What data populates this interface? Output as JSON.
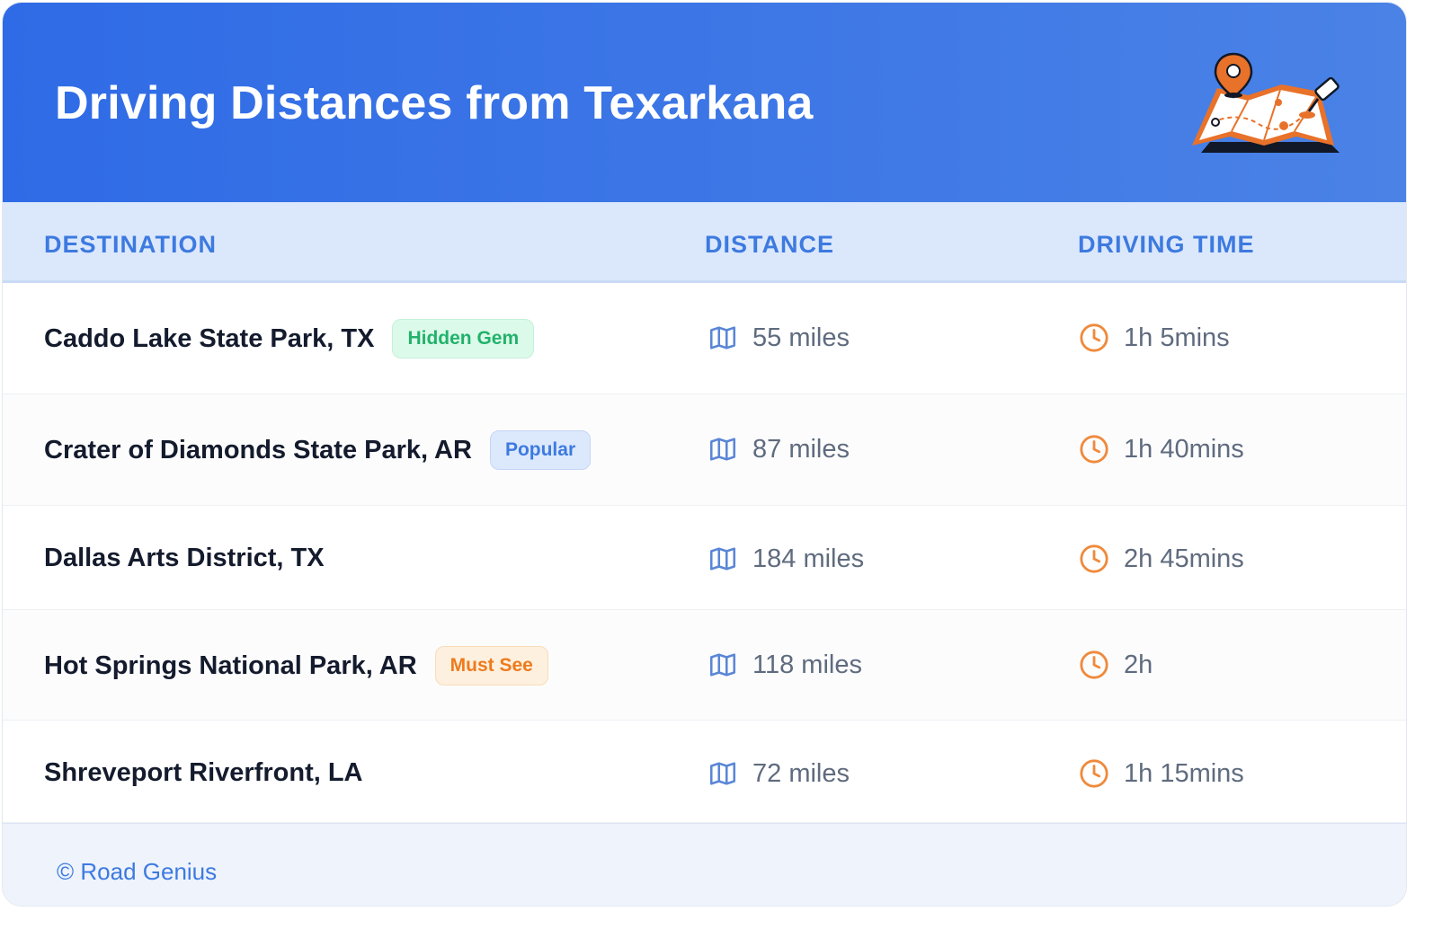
{
  "title": "Driving Distances from Texarkana",
  "columns": {
    "destination": "DESTINATION",
    "distance": "DISTANCE",
    "driving_time": "DRIVING TIME"
  },
  "rows": [
    {
      "destination": "Caddo Lake State Park, TX",
      "badge": "Hidden Gem",
      "badge_color": "#22b26b",
      "distance": "55 miles",
      "time": "1h 5mins"
    },
    {
      "destination": "Crater of Diamonds State Park, AR",
      "badge": "Popular",
      "badge_color": "#3d7ae0",
      "distance": "87 miles",
      "time": "1h 40mins"
    },
    {
      "destination": "Dallas Arts District, TX",
      "badge": "",
      "distance": "184 miles",
      "time": "2h 45mins"
    },
    {
      "destination": "Hot Springs National Park, AR",
      "badge": "Must See",
      "badge_color": "#ef7a1c",
      "distance": "118 miles",
      "time": "2h"
    },
    {
      "destination": "Shreveport Riverfront, LA",
      "badge": "",
      "distance": "72 miles",
      "time": "1h 15mins"
    }
  ],
  "footer": {
    "credit": "© Road Genius"
  },
  "icons": {
    "distance": "map-icon",
    "time": "clock-icon",
    "header": "map-illustration"
  },
  "colors": {
    "header_bg": "#2f6be6",
    "accent": "#3d7ae0",
    "clock": "#ef8a3c"
  }
}
